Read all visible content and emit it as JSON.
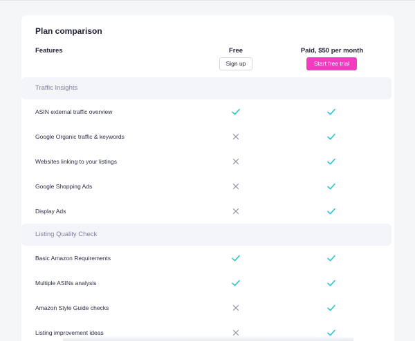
{
  "title": "Plan comparison",
  "columns": {
    "features": "Features",
    "free": "Free",
    "paid": "Paid, $50 per month"
  },
  "buttons": {
    "signup": "Sign up",
    "trial": "Start free trial"
  },
  "colors": {
    "check": "#2ec4cf",
    "cross": "#9a9cae",
    "trial_button": "#f23bbf"
  },
  "sections": [
    {
      "label": "Traffic Insights",
      "rows": [
        {
          "label": "ASIN external traffic overview",
          "free": true,
          "paid": true
        },
        {
          "label": "Google Organic traffic & keywords",
          "free": false,
          "paid": true
        },
        {
          "label": "Websites linking to your listings",
          "free": false,
          "paid": true
        },
        {
          "label": "Google Shopping Ads",
          "free": false,
          "paid": true
        },
        {
          "label": "Display Ads",
          "free": false,
          "paid": true
        }
      ]
    },
    {
      "label": "Listing Quality Check",
      "rows": [
        {
          "label": "Basic Amazon Requirements",
          "free": true,
          "paid": true
        },
        {
          "label": "Multiple ASINs analysis",
          "free": true,
          "paid": true
        },
        {
          "label": "Amazon Style Guide checks",
          "free": false,
          "paid": true
        },
        {
          "label": "Listing improvement ideas",
          "free": false,
          "paid": true
        }
      ]
    }
  ]
}
